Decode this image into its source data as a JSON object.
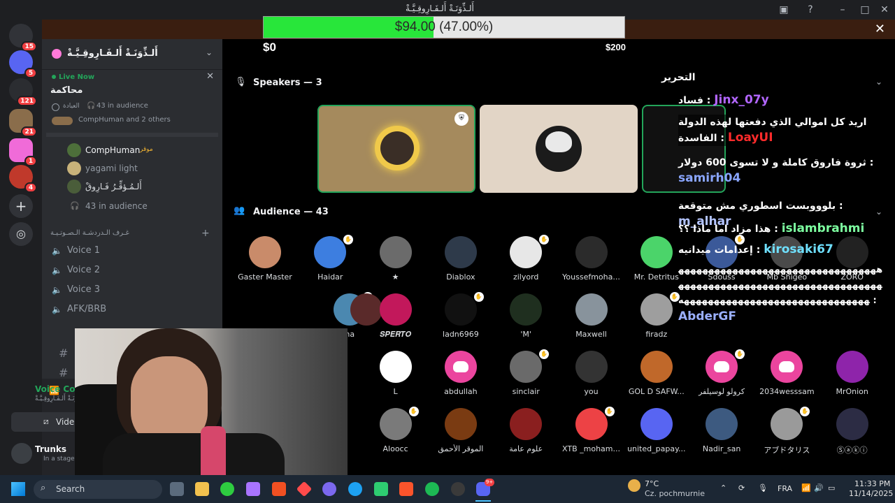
{
  "window": {
    "title": "أَلـذِّوَنَـةْ أَلـفَـارِوقِـيَّـةْ"
  },
  "goal": {
    "text": "$94.00 (47.00%)",
    "min_label": "$0",
    "max_label": "$200",
    "progress_fraction": 0.47
  },
  "rail": {
    "badges": [
      "15",
      "5",
      "121",
      "21",
      "1",
      "4"
    ]
  },
  "sidebar": {
    "server_name": "أَلـذِّوَنَـةْ أَلـفَـارِوقِـيَّـةْ",
    "live": {
      "status": "Live Now",
      "stage_name": "محاكمة",
      "meta_left": "العيادة",
      "meta_audience": "43 in audience",
      "participants": "CompHuman and 2 others"
    },
    "stage_members": [
      {
        "name": "CompHuman",
        "tag": "موقر"
      },
      {
        "name": "yagami light",
        "tag": ""
      },
      {
        "name": "أَلـمُـؤقِّـرُ فَـارِوقْ",
        "tag": ""
      }
    ],
    "audience_count": "43 in audience",
    "category": "غـرف الـدردشـة الـصـوتـيـة",
    "voice_channels": [
      "Voice 1",
      "Voice 2",
      "Voice 3",
      "AFK/BRB"
    ],
    "voice_connected": {
      "label": "Voice Con",
      "sub": "أَلـذِّوَنَـةْ أَلـفَـارِوقِـيَّـةْ"
    },
    "video_button": "Vide",
    "user": {
      "name": "Trunks",
      "status": "In a stage"
    }
  },
  "stage": {
    "speakers_title": "Speakers — 3",
    "audience_title": "Audience — 43",
    "audience": [
      {
        "name": "Gaster Master",
        "color": "#c98b6a"
      },
      {
        "name": "Haidar",
        "color": "#3d7ee0"
      },
      {
        "name": "★",
        "color": "#6b6b6b"
      },
      {
        "name": "Diablox",
        "color": "#2e3a4a"
      },
      {
        "name": "zilyord",
        "color": "#e7e7e7"
      },
      {
        "name": "Youssefmoha...",
        "color": "#2b2b2b"
      },
      {
        "name": "Mr. Detritus",
        "color": "#4bd46a"
      },
      {
        "name": "Sdouss",
        "color": "#3b5999"
      },
      {
        "name": "Mb Shigeo",
        "color": "#4a4a4a"
      },
      {
        "name": "ZORO",
        "color": "#222222"
      },
      {
        "name": "ha",
        "color": "#4b88b0"
      },
      {
        "name": "",
        "color": "#5a2a2a"
      },
      {
        "name": "𝑺𝑷𝑬𝑹𝑻𝑶",
        "color": "#c2185b"
      },
      {
        "name": "ladn6969",
        "color": "#111111"
      },
      {
        "name": "'M'",
        "color": "#1f2f1f"
      },
      {
        "name": "Maxwell",
        "color": "#88939c"
      },
      {
        "name": "firadz",
        "color": "#9e9e9e"
      },
      {
        "name": "L",
        "color": "#ffffff"
      },
      {
        "name": "abdullah",
        "color": "discord"
      },
      {
        "name": "sinclair",
        "color": "#6a6a6a"
      },
      {
        "name": "you",
        "color": "#333333"
      },
      {
        "name": "GOL D SAFW...",
        "color": "#c0682a"
      },
      {
        "name": "كرولو لوسيلفر",
        "color": "discord"
      },
      {
        "name": "2034wesssam",
        "color": "discord"
      },
      {
        "name": "MrOnion",
        "color": "#8e24aa"
      },
      {
        "name": "Aloocc",
        "color": "#7a7a7a"
      },
      {
        "name": "الموقر الأحمق",
        "color": "#7a3b12"
      },
      {
        "name": "علوم عامة",
        "color": "#8a1f1f"
      },
      {
        "name": "XTB _moham...",
        "color": "#ed4245"
      },
      {
        "name": "united_papay...",
        "color": "#5865f2"
      },
      {
        "name": "Nadir_san",
        "color": "#3d5a80"
      },
      {
        "name": "アブドタリス",
        "color": "#9a9a9a"
      },
      {
        "name": "Ⓢⓐⓚⓘ",
        "color": "#2c2c44"
      }
    ]
  },
  "chat": {
    "header": "التحرير",
    "messages": [
      {
        "user": "Jinx_07y",
        "user_color": "#b266ff",
        "text": "فساد"
      },
      {
        "user": "LoayUI",
        "user_color": "#ff2b2b",
        "text": "اريد كل اموالي الذي دفعتها لهذه الدولة الفاسدة"
      },
      {
        "user": "samirh04",
        "user_color": "#8aa6ff",
        "text": "ثروة فاروق كاملة و لا تسوى 600 دولار"
      },
      {
        "user": "m_alhar",
        "user_color": "#b3c4ff",
        "text": "بلوووبست اسطوري مش متوقعة"
      },
      {
        "user": "islambrahmi",
        "user_color": "#7dffa0",
        "text": "هذا مزاد اما ماذا ؟؟"
      },
      {
        "user": "kirosaki67",
        "user_color": "#6fe0ff",
        "text": "إعدامات ميدانيه"
      },
      {
        "user": "AbderGF",
        "user_color": "#9bb0ff",
        "text": "هههههههههههههههههههههههههههههههههههههههههههههههههههههههههههههههههههههههههههههههههههههههههههههههههههه"
      }
    ]
  },
  "taskbar": {
    "search_placeholder": "Search",
    "weather_temp": "7°C",
    "weather_desc": "Cz. pochmurnie",
    "language": "FRA",
    "time": "11:33 PM",
    "date": "11/14/2025",
    "discord_badge": "9+"
  }
}
